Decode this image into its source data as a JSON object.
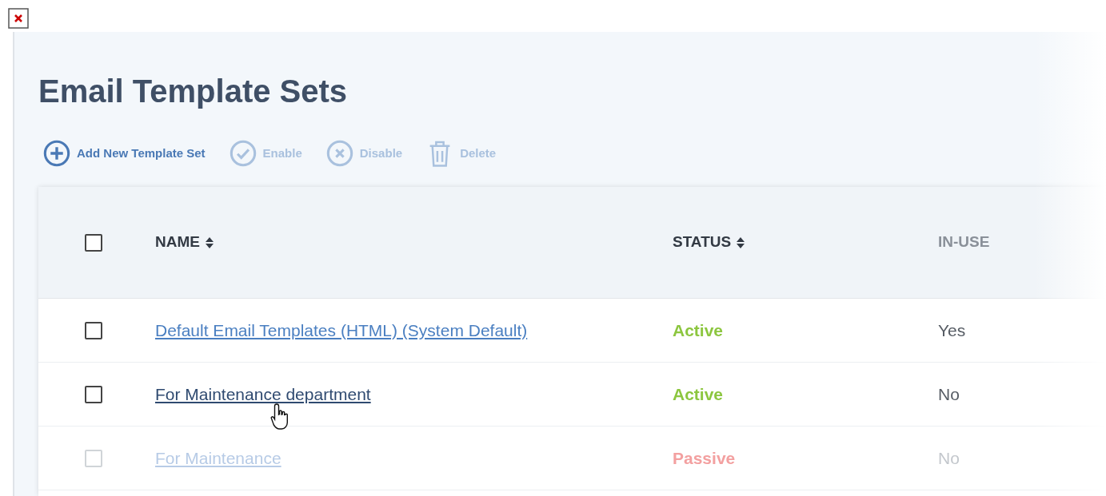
{
  "page": {
    "title": "Email Template Sets"
  },
  "toolbar": [
    {
      "kind": "add",
      "label": "Add New Template Set",
      "disabled": false
    },
    {
      "kind": "enable",
      "label": "Enable",
      "disabled": true
    },
    {
      "kind": "disable",
      "label": "Disable",
      "disabled": true
    },
    {
      "kind": "delete",
      "label": "Delete",
      "disabled": true
    }
  ],
  "table": {
    "select_all": {
      "checked": false
    },
    "columns": [
      {
        "label": "NAME",
        "sortable": true
      },
      {
        "label": "STATUS",
        "sortable": true
      },
      {
        "label": "IN-USE",
        "sortable": false
      }
    ],
    "rows": [
      {
        "checked": false,
        "name": "Default Email Templates (HTML) (System Default)",
        "status": "Active",
        "color": "#8cc63f",
        "in_use": "Yes",
        "faded": false,
        "hovered": false
      },
      {
        "checked": false,
        "name": "For Maintenance department",
        "status": "Active",
        "color": "#8cc63f",
        "in_use": "No",
        "faded": false,
        "hovered": true
      },
      {
        "checked": false,
        "name": "For Maintenance",
        "status": "Passive",
        "color": "#f3a0a0",
        "in_use": "No",
        "faded": true,
        "hovered": false
      }
    ]
  }
}
